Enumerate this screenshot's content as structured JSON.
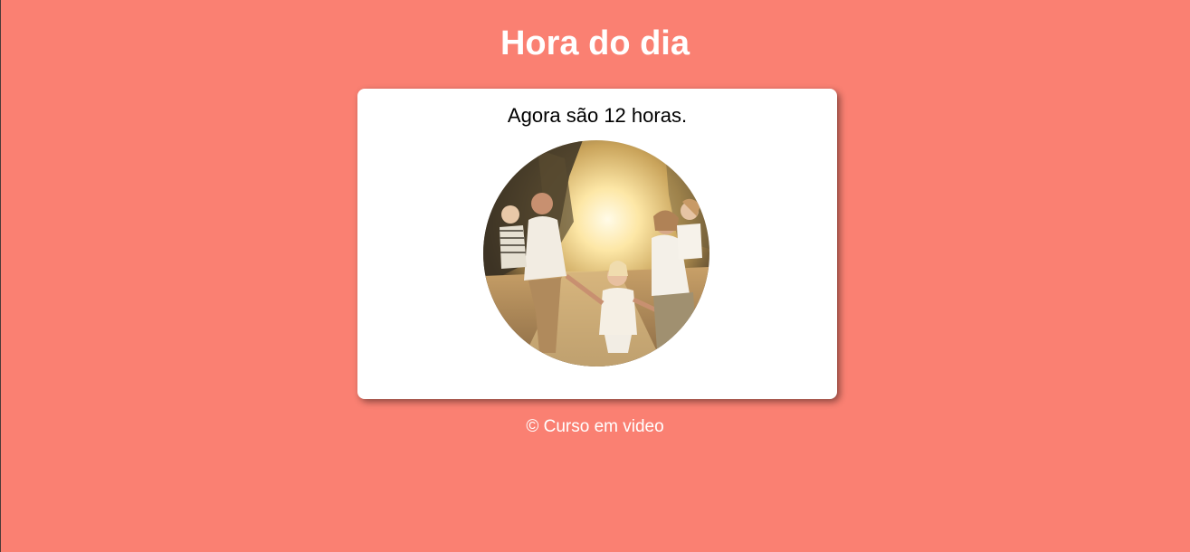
{
  "header": {
    "title": "Hora do dia"
  },
  "card": {
    "message": "Agora são 12 horas.",
    "photo_icon": "family-photo"
  },
  "footer": {
    "copyright": "© Curso em video"
  },
  "colors": {
    "background": "#fa8072",
    "card": "#ffffff",
    "title": "#ffffff",
    "message": "#000000"
  }
}
